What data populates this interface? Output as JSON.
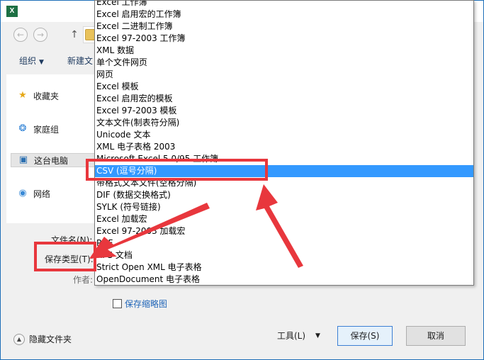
{
  "app": {
    "icon_text": "X",
    "close_glyph": "✕"
  },
  "navbar": {
    "back_glyph": "←",
    "forward_glyph": "→",
    "up_glyph": "↑"
  },
  "toolbar": {
    "organize_label": "组织",
    "new_folder_label": "新建文"
  },
  "sidebar": {
    "items": [
      {
        "label": "收藏夹",
        "icon": "star-icon"
      },
      {
        "label": "家庭组",
        "icon": "homegroup-icon"
      },
      {
        "label": "这台电脑",
        "icon": "computer-icon"
      },
      {
        "label": "网络",
        "icon": "network-icon"
      }
    ]
  },
  "form": {
    "filename_label": "文件名(N):",
    "savetype_label": "保存类型(T):",
    "author_label": "作者:"
  },
  "dropdown": {
    "options": [
      "Excel 工作簿",
      "Excel 启用宏的工作簿",
      "Excel 二进制工作簿",
      "Excel 97-2003 工作簿",
      "XML 数据",
      "单个文件网页",
      "网页",
      "Excel 模板",
      "Excel 启用宏的模板",
      "Excel 97-2003 模板",
      "文本文件(制表符分隔)",
      "Unicode 文本",
      "XML 电子表格 2003",
      "Microsoft Excel 5.0/95 工作簿",
      "CSV (逗号分隔)",
      "带格式文本文件(空格分隔)",
      "DIF (数据交换格式)",
      "SYLK (符号链接)",
      "Excel 加载宏",
      "Excel 97-2003 加载宏",
      "PDF",
      "XPS 文档",
      "Strict Open XML 电子表格",
      "OpenDocument 电子表格"
    ],
    "selected_index": 14
  },
  "thumbnail": {
    "label": "保存缩略图"
  },
  "footer": {
    "hide_folders_label": "隐藏文件夹",
    "tools_label": "工具(L)",
    "save_label": "保存(S)",
    "cancel_label": "取消"
  },
  "colors": {
    "highlight": "#3399ff",
    "annotation_red": "#e8373d",
    "window_border": "#1e6fb8"
  }
}
